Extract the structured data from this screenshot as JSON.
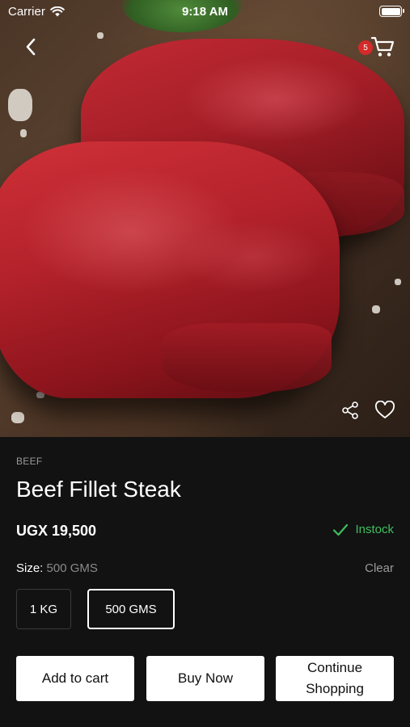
{
  "status_bar": {
    "carrier": "Carrier",
    "time": "9:18 AM"
  },
  "header": {
    "back_icon": "chevron-left-icon",
    "cart_icon": "cart-icon",
    "cart_count": "5"
  },
  "image_actions": {
    "share_icon": "share-icon",
    "favorite_icon": "heart-icon"
  },
  "product": {
    "category": "BEEF",
    "name": "Beef Fillet Steak",
    "price": "UGX 19,500",
    "stock_status": "Instock"
  },
  "size": {
    "label": "Size:",
    "selected": "500 GMS",
    "clear_label": "Clear",
    "options": [
      "1 KG",
      "500 GMS"
    ]
  },
  "actions": {
    "add_to_cart": "Add to cart",
    "buy_now": "Buy Now",
    "continue_shopping": "Continue Shopping"
  },
  "colors": {
    "background": "#121212",
    "instock_green": "#3fbf5f",
    "badge_red": "#d42a2a",
    "button_bg": "#ffffff"
  }
}
